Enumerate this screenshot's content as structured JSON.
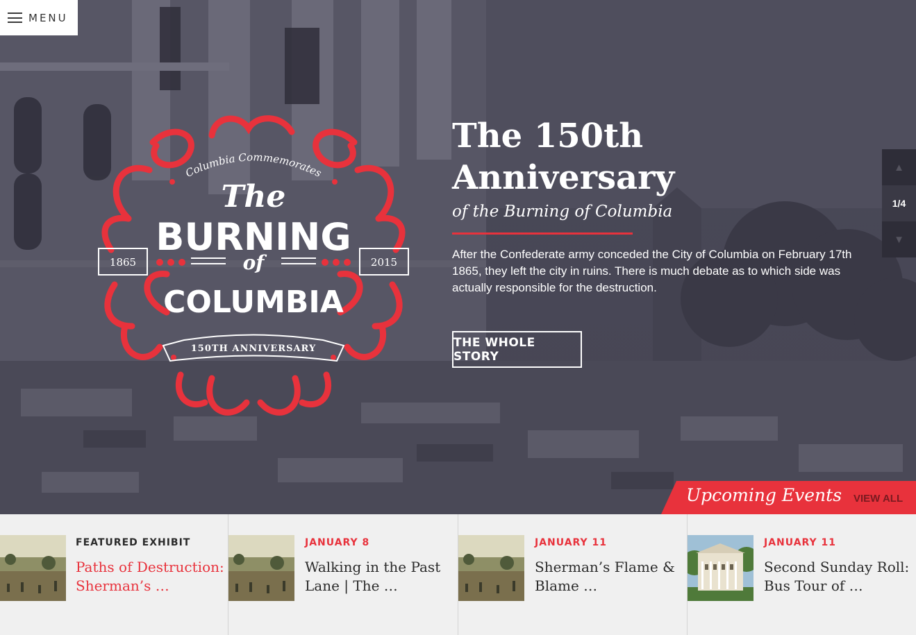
{
  "menu": {
    "label": "MENU"
  },
  "hero": {
    "title": "The 150th Anniversary",
    "subtitle": "of the Burning of Columbia",
    "description": "After the Confederate army conceded the City of Columbia on February 17th 1865, they left the city in ruins. There is much debate as to which side was actually responsible for the destruction.",
    "button_label": "THE WHOLE STORY",
    "accent_color": "#e8323c"
  },
  "logo": {
    "top_text": "Columbia Commemorates",
    "the_text": "The",
    "burning_text": "BURNING",
    "of_text": "of",
    "columbia_text": "COLUMBIA",
    "year_left": "1865",
    "year_right": "2015",
    "ribbon_text": "150TH ANNIVERSARY"
  },
  "slider": {
    "up_icon": "triangle-up-icon",
    "counter": "1/4",
    "down_icon": "triangle-down-icon"
  },
  "events": {
    "title": "Upcoming Events",
    "view_all": "VIEW ALL",
    "cards": [
      {
        "label": "FEATURED EXHIBIT",
        "title": "Paths of Destruction: Sherman’s …",
        "label_color": "#2a2a2a",
        "title_color": "#e8323c"
      },
      {
        "label": "JANUARY 8",
        "title": "Walking in the Past Lane | The …",
        "label_color": "#e8323c",
        "title_color": "#2a2a2a"
      },
      {
        "label": "JANUARY 11",
        "title": "Sherman’s Flame & Blame …",
        "label_color": "#e8323c",
        "title_color": "#2a2a2a"
      },
      {
        "label": "JANUARY 11",
        "title": "Second Sunday Roll: Bus Tour of …",
        "label_color": "#e8323c",
        "title_color": "#2a2a2a"
      }
    ]
  }
}
